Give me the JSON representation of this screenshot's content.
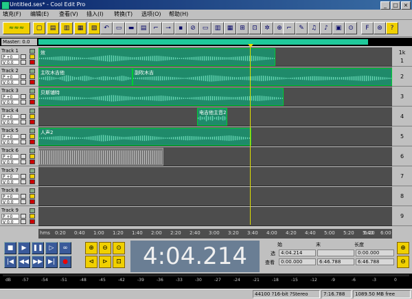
{
  "window": {
    "title": "Untitled.ses* - Cool Edit Pro"
  },
  "menu": [
    "填充(F)",
    "编辑(E)",
    "查看(V)",
    "插入(I)",
    "转换(T)",
    "选项(O)",
    "帮助(H)"
  ],
  "master": {
    "label": "Master: 0.0"
  },
  "tracks": [
    {
      "name": "Track 1",
      "pan": "P +0",
      "vol": "V 0.0",
      "num": "1"
    },
    {
      "name": "Track 2",
      "pan": "P +0",
      "vol": "V 0.0",
      "num": "2"
    },
    {
      "name": "Track 3",
      "pan": "P +0",
      "vol": "V 0.0",
      "num": "3"
    },
    {
      "name": "Track 4",
      "pan": "P +0",
      "vol": "V 0.0",
      "num": "4"
    },
    {
      "name": "Track 5",
      "pan": "P +0",
      "vol": "V 0.0",
      "num": "5"
    },
    {
      "name": "Track 6",
      "pan": "P +0",
      "vol": "V 0.0",
      "num": "6"
    },
    {
      "name": "Track 7",
      "pan": "P +0",
      "vol": "V 0.0",
      "num": "7"
    },
    {
      "name": "Track 8",
      "pan": "P +0",
      "vol": "V 0.0",
      "num": "8"
    },
    {
      "name": "Track 9",
      "pan": "P +0",
      "vol": "V 0.0",
      "num": "9"
    }
  ],
  "right_header": "1k",
  "clips": {
    "t1": "效",
    "t2a": "主吹木吉他",
    "t2b": "副吹木吉",
    "t3": "贝斯铺特",
    "t4": "电吉他主音2",
    "t5": "人声2"
  },
  "ruler": {
    "unit": "hms",
    "ticks": [
      "0:20",
      "0:40",
      "1:00",
      "1:20",
      "1:40",
      "2:00",
      "2:20",
      "2:40",
      "3:00",
      "3:20",
      "3:40",
      "4:00",
      "4:20",
      "4:40",
      "5:00",
      "5:20",
      "5:40",
      "6:00",
      "6:20"
    ]
  },
  "transport": {
    "time": "4:04.214"
  },
  "selection": {
    "col_start": "始",
    "col_end": "末",
    "col_length": "长度",
    "row_sel": "选",
    "row_view": "查看",
    "sel_start": "4:04.214",
    "sel_end": "",
    "sel_length": "0:00.000",
    "view_start": "0:00.000",
    "view_end": "6:46.788",
    "view_length": "6:46.788"
  },
  "meter": {
    "ticks": [
      "dB",
      "-57",
      "-54",
      "-51",
      "-48",
      "-45",
      "-42",
      "-39",
      "-36",
      "-33",
      "-30",
      "-27",
      "-24",
      "-21",
      "-18",
      "-15",
      "-12",
      "-9",
      "-6",
      "-3",
      "0"
    ]
  },
  "status": {
    "format": "44100 ?16-bit ?Stereo",
    "duration": "7:16.788",
    "free": "1089.50 MB free"
  }
}
